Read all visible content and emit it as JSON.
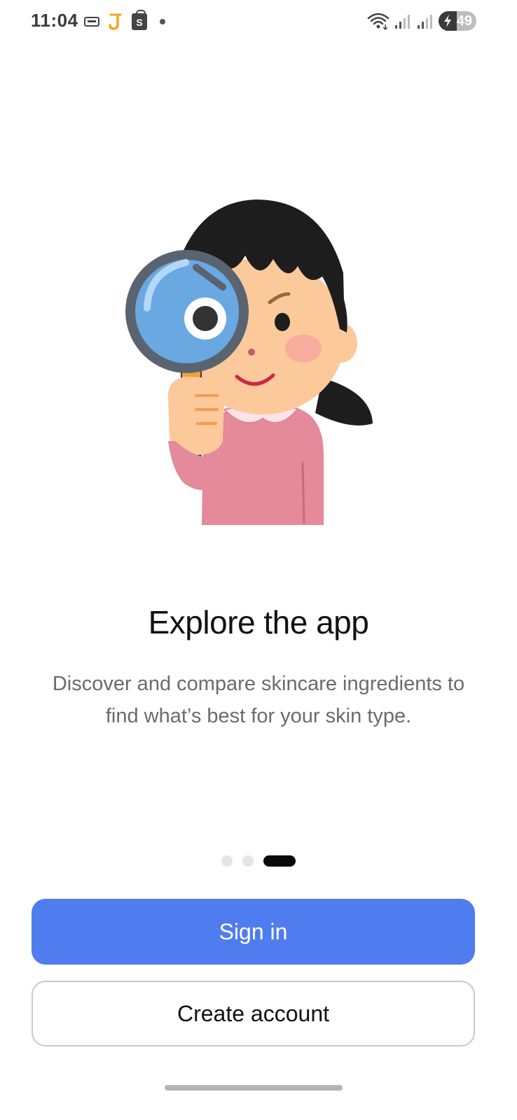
{
  "status_bar": {
    "time": "11:04",
    "left_icons": [
      "card-icon",
      "j-app-icon",
      "shopping-bag-icon",
      "dot-icon"
    ],
    "shopping_bag_letter": "S",
    "right_icons": [
      "wifi-icon",
      "signal-icon",
      "signal-icon",
      "battery-icon"
    ],
    "battery_level": "49"
  },
  "onboarding": {
    "illustration": "girl-with-magnifying-glass",
    "title": "Explore the app",
    "subtitle": "Discover and compare skincare ingredients to find what’s best for your skin type.",
    "pager": {
      "total": 3,
      "active_index": 2
    }
  },
  "actions": {
    "sign_in_label": "Sign in",
    "create_account_label": "Create account"
  },
  "colors": {
    "primary": "#4f7cef",
    "title": "#111111",
    "subtitle": "#6b6b6b",
    "pager_active": "#0a0a0a",
    "pager_inactive": "#e4e4e4"
  }
}
